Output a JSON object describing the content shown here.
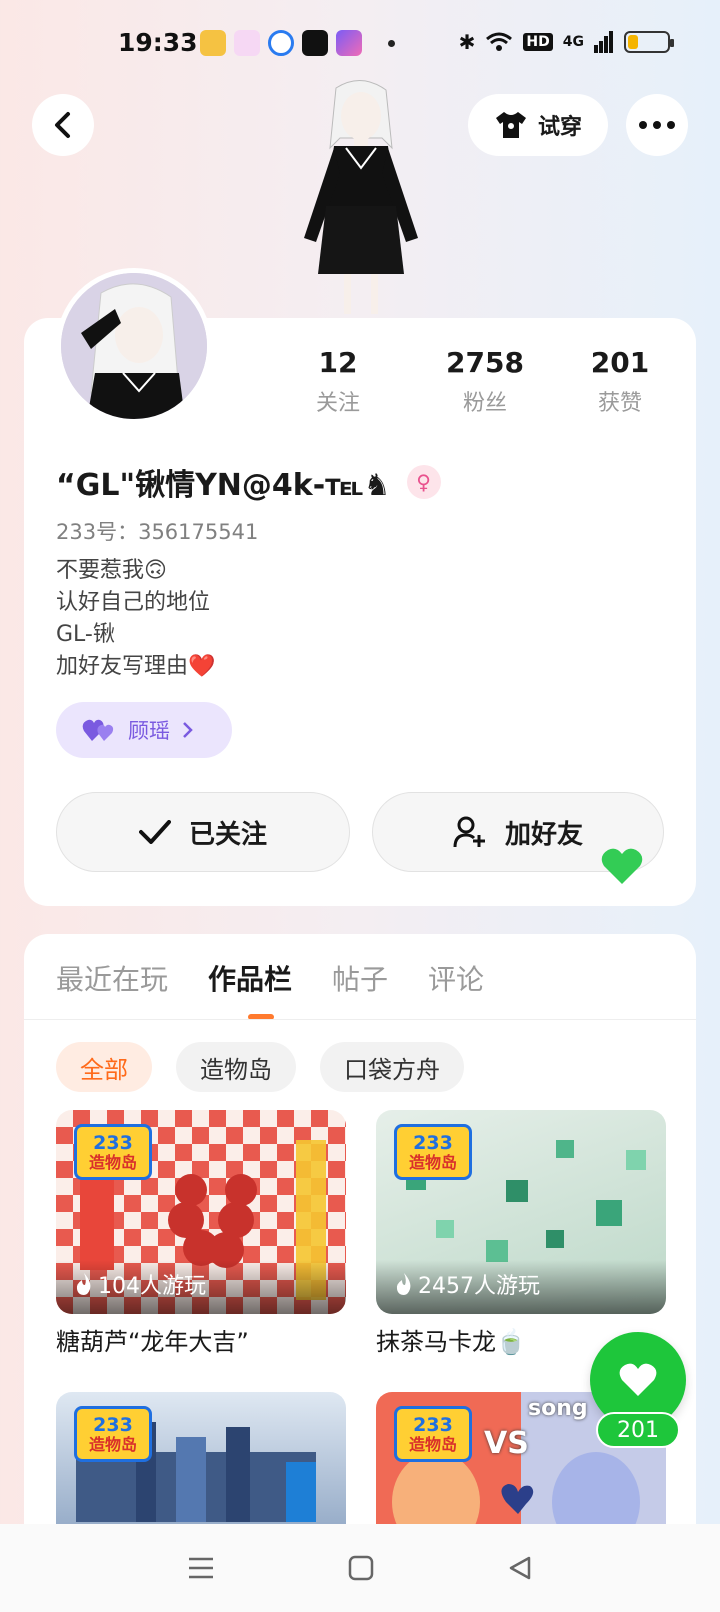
{
  "status_bar": {
    "time": "19:33",
    "network": "4G",
    "hd": "HD",
    "battery_level": 0.25,
    "app_icons": [
      "weibo-icon",
      "pink-app-icon",
      "blue-app-icon",
      "video-app-icon",
      "purple-app-icon"
    ]
  },
  "header": {
    "try_on_label": "试穿"
  },
  "stats": [
    {
      "value": "12",
      "label": "关注"
    },
    {
      "value": "2758",
      "label": "粉丝"
    },
    {
      "value": "201",
      "label": "获赞"
    }
  ],
  "profile": {
    "nickname": "“GL\"锹情YN@4k-℡♞",
    "uid": "233号：356175541",
    "bio_lines": [
      "不要惹我🙃",
      "认好自己的地位",
      "GL-锹",
      "加好友写理由❤️"
    ],
    "partner_name": "顾瑶"
  },
  "actions": {
    "followed_label": "已关注",
    "add_friend_label": "加好友"
  },
  "tabs": [
    "最近在玩",
    "作品栏",
    "帖子",
    "评论"
  ],
  "active_tab": "作品栏",
  "filters": [
    "全部",
    "造物岛",
    "口袋方舟"
  ],
  "works": [
    {
      "title": "糖葫芦“龙年大吉”",
      "plays": "104人游玩",
      "badge_top": "233",
      "badge_bottom": "造物岛"
    },
    {
      "title": "抹茶马卡龙🍵",
      "plays": "2457人游玩",
      "badge_top": "233",
      "badge_bottom": "造物岛"
    },
    {
      "title": "",
      "plays": "",
      "badge_top": "233",
      "badge_bottom": "造物岛"
    },
    {
      "title": "",
      "plays": "",
      "badge_top": "233",
      "badge_bottom": "造物岛",
      "overlay_text": "VS",
      "overlay_text_2": "song"
    }
  ],
  "like_fab": {
    "count": "201"
  },
  "colors": {
    "accent": "#ff7a2e",
    "like_green": "#1ec63b",
    "partner_purple": "#7a5ae0",
    "gender_pink": "#e9528e"
  }
}
